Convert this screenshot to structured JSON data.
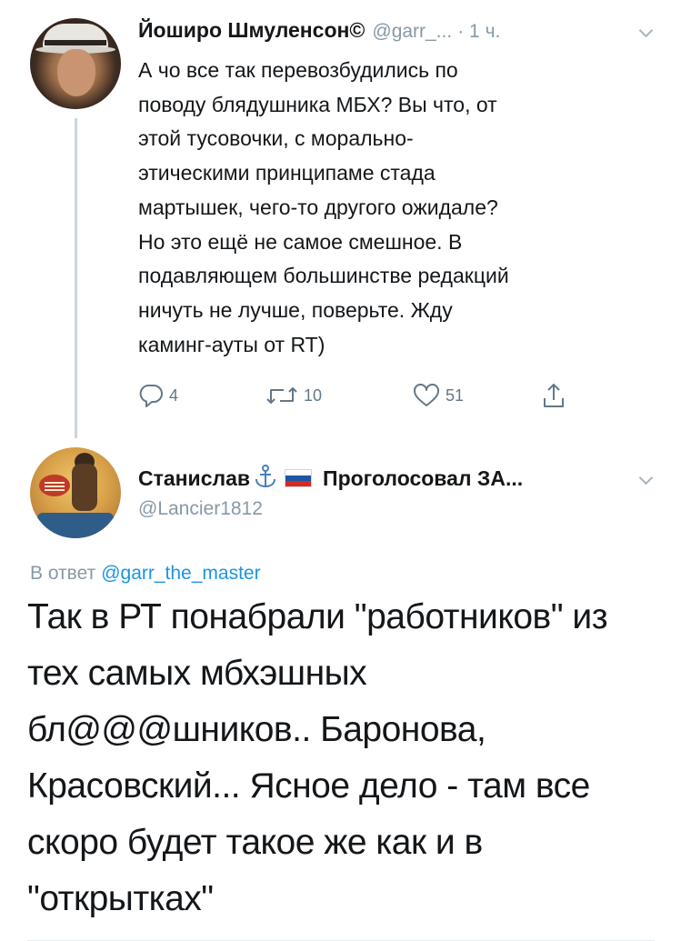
{
  "tweet1": {
    "author_name": "Йоширо Шмуленсон©",
    "handle": "@garr_...",
    "time": "· 1 ч.",
    "text": "А чо все так перевозбудились по\nповоду блядушника МБХ? Вы что, от\nэтой тусовочки, с морально-\nэтическими принципаме стада\nмартышек, чего-то другого ожидале?\nНо это ещё не самое смешное. В\nподавляющем большинстве редакций\nничуть не лучше, поверьте. Жду\nкаминг-ауты от RT)",
    "actions": {
      "reply_count": "4",
      "retweet_count": "10",
      "like_count": "51"
    }
  },
  "tweet2": {
    "author_name": "Станислав",
    "author_suffix": "Проголосовал ЗА...",
    "handle": "@Lancier1812",
    "reply_prefix": "В ответ",
    "reply_mention": "@garr_the_master",
    "text": "Так в РТ понабрали \"работников\" из\nтех самых мбхэшных\nбл@@@шников.. Баронова,\nКрасовский... Ясное дело - там все\nскоро будет такое же как и в\n\"открытках\""
  },
  "icons": {
    "reply": "reply-icon",
    "retweet": "retweet-icon",
    "like": "heart-icon",
    "share": "share-icon",
    "menu": "chevron-down-icon",
    "anchor": "anchor-emoji-icon",
    "flag": "russia-flag-icon"
  },
  "colors": {
    "text_primary": "#14171a",
    "text_secondary": "#8899a6",
    "action_grey": "#657786",
    "link_blue": "#1b95e0",
    "thread_line": "#ccd6dd"
  }
}
